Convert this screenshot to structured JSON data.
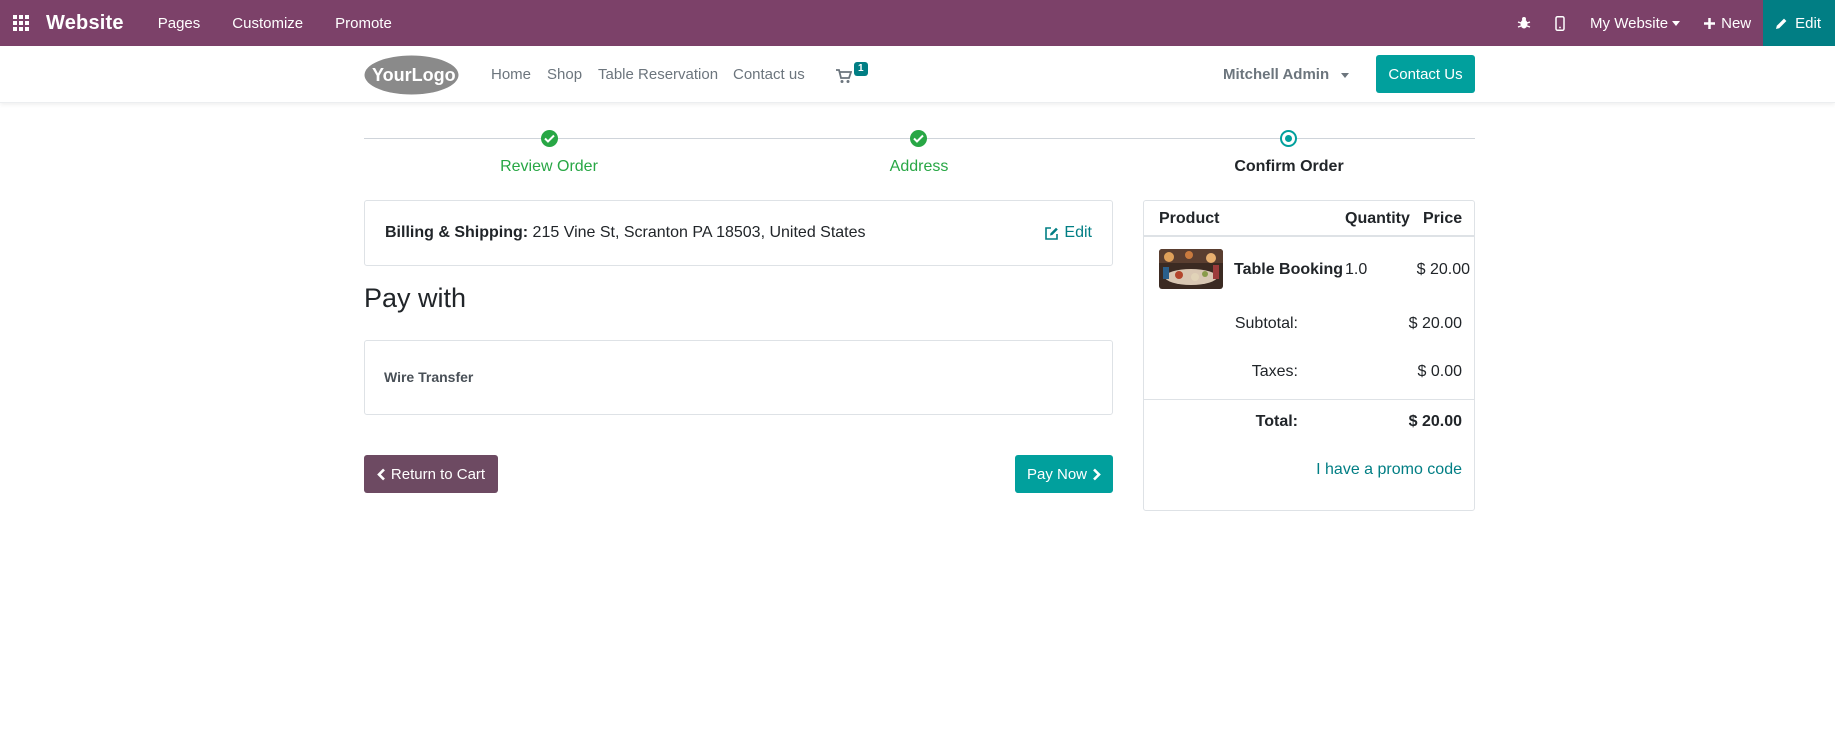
{
  "topbar": {
    "brand": "Website",
    "menu": [
      "Pages",
      "Customize",
      "Promote"
    ],
    "website_selector": "My Website",
    "new_label": "New",
    "edit_label": "Edit"
  },
  "header": {
    "logo_text": "YourLogo",
    "nav": [
      "Home",
      "Shop",
      "Table Reservation",
      "Contact us"
    ],
    "cart_count": "1",
    "user": "Mitchell Admin",
    "contact_button": "Contact Us"
  },
  "wizard": {
    "steps": [
      {
        "label": "Review Order",
        "state": "done"
      },
      {
        "label": "Address",
        "state": "done"
      },
      {
        "label": "Confirm Order",
        "state": "current"
      }
    ]
  },
  "billing": {
    "label": "Billing & Shipping:",
    "address": "215 Vine St, Scranton PA 18503, United States",
    "edit_label": "Edit"
  },
  "payment": {
    "heading": "Pay with",
    "methods": [
      "Wire Transfer"
    ],
    "return_label": "Return to Cart",
    "pay_label": "Pay Now"
  },
  "summary": {
    "headers": {
      "product": "Product",
      "quantity": "Quantity",
      "price": "Price"
    },
    "lines": [
      {
        "name": "Table Booking",
        "quantity": "1.0",
        "price": "$ 20.00"
      }
    ],
    "subtotal_label": "Subtotal:",
    "subtotal": "$ 20.00",
    "taxes_label": "Taxes:",
    "taxes": "$ 0.00",
    "total_label": "Total:",
    "total": "$ 20.00",
    "promo_label": "I have a promo code"
  },
  "colors": {
    "admin_bar": "#7c4169",
    "primary": "#01a09d",
    "edit_button": "#017e84",
    "success": "#28a745",
    "secondary_button": "#6d4a62"
  }
}
